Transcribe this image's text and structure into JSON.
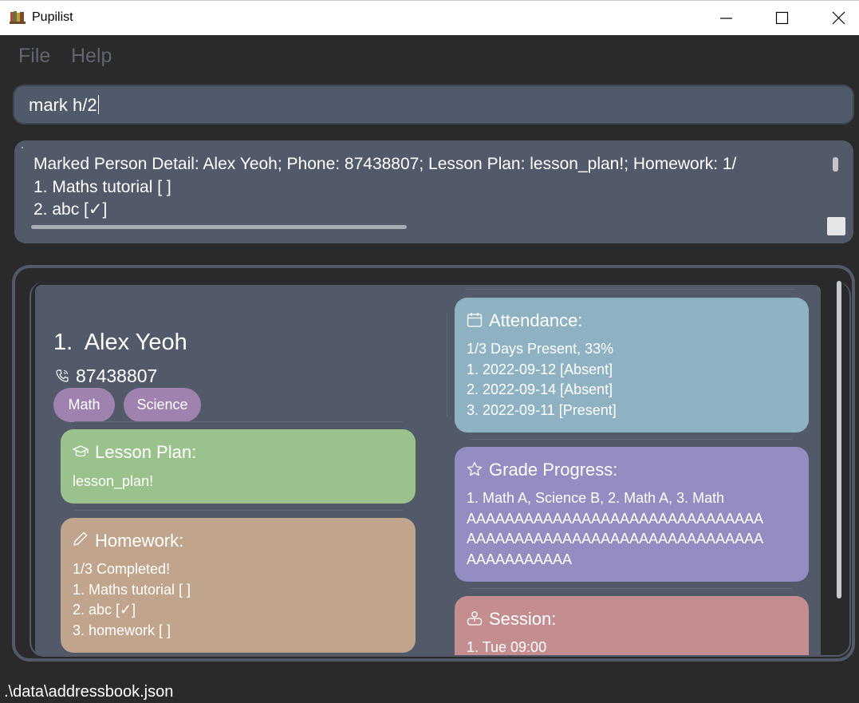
{
  "window": {
    "title": "Pupilist"
  },
  "menu": {
    "file": "File",
    "help": "Help"
  },
  "command": {
    "value": "mark h/2"
  },
  "result": {
    "lines": "Marked Person Detail: Alex Yeoh; Phone: 87438807; Lesson Plan: lesson_plan!; Homework: 1/\n1. Maths tutorial [ ]\n2. abc [✓]"
  },
  "person": {
    "index_name": "1.  Alex Yeoh",
    "phone": "87438807",
    "tags": [
      "Math",
      "Science"
    ],
    "lesson_plan": {
      "title": "Lesson Plan:",
      "body": "lesson_plan!"
    },
    "homework": {
      "title": "Homework:",
      "body": "1/3 Completed!\n1. Maths tutorial [ ]\n2. abc [✓]\n3. homework [ ]"
    },
    "attendance": {
      "title": "Attendance:",
      "body": "1/3 Days Present, 33%\n1. 2022-09-12 [Absent]\n2. 2022-09-14 [Absent]\n3. 2022-09-11 [Present]"
    },
    "grade_progress": {
      "title": "Grade Progress:",
      "body": "1. Math A, Science B, 2. Math A, 3. Math\nAAAAAAAAAAAAAAAAAAAAAAAAAAAAAAA\nAAAAAAAAAAAAAAAAAAAAAAAAAAAAAAA\nAAAAAAAAAAA"
    },
    "session": {
      "title": "Session:",
      "body": "1. Tue 09:00"
    }
  },
  "status": {
    "path": ".\\data\\addressbook.json"
  },
  "colors": {
    "background": "#2a2a2a",
    "card": "#525a6a",
    "tag": "#9f82b0",
    "lesson_plan": "#9bc28c",
    "homework": "#c0a48c",
    "attendance": "#8fb2c2",
    "grade_progress": "#938dc2",
    "session": "#c48e90"
  },
  "icons": {
    "app": "books-icon",
    "phone": "phone-icon",
    "lesson_plan": "graduation-cap-icon",
    "homework": "pencil-icon",
    "attendance": "calendar-icon",
    "grade_progress": "star-icon",
    "session": "person-presenting-icon"
  }
}
